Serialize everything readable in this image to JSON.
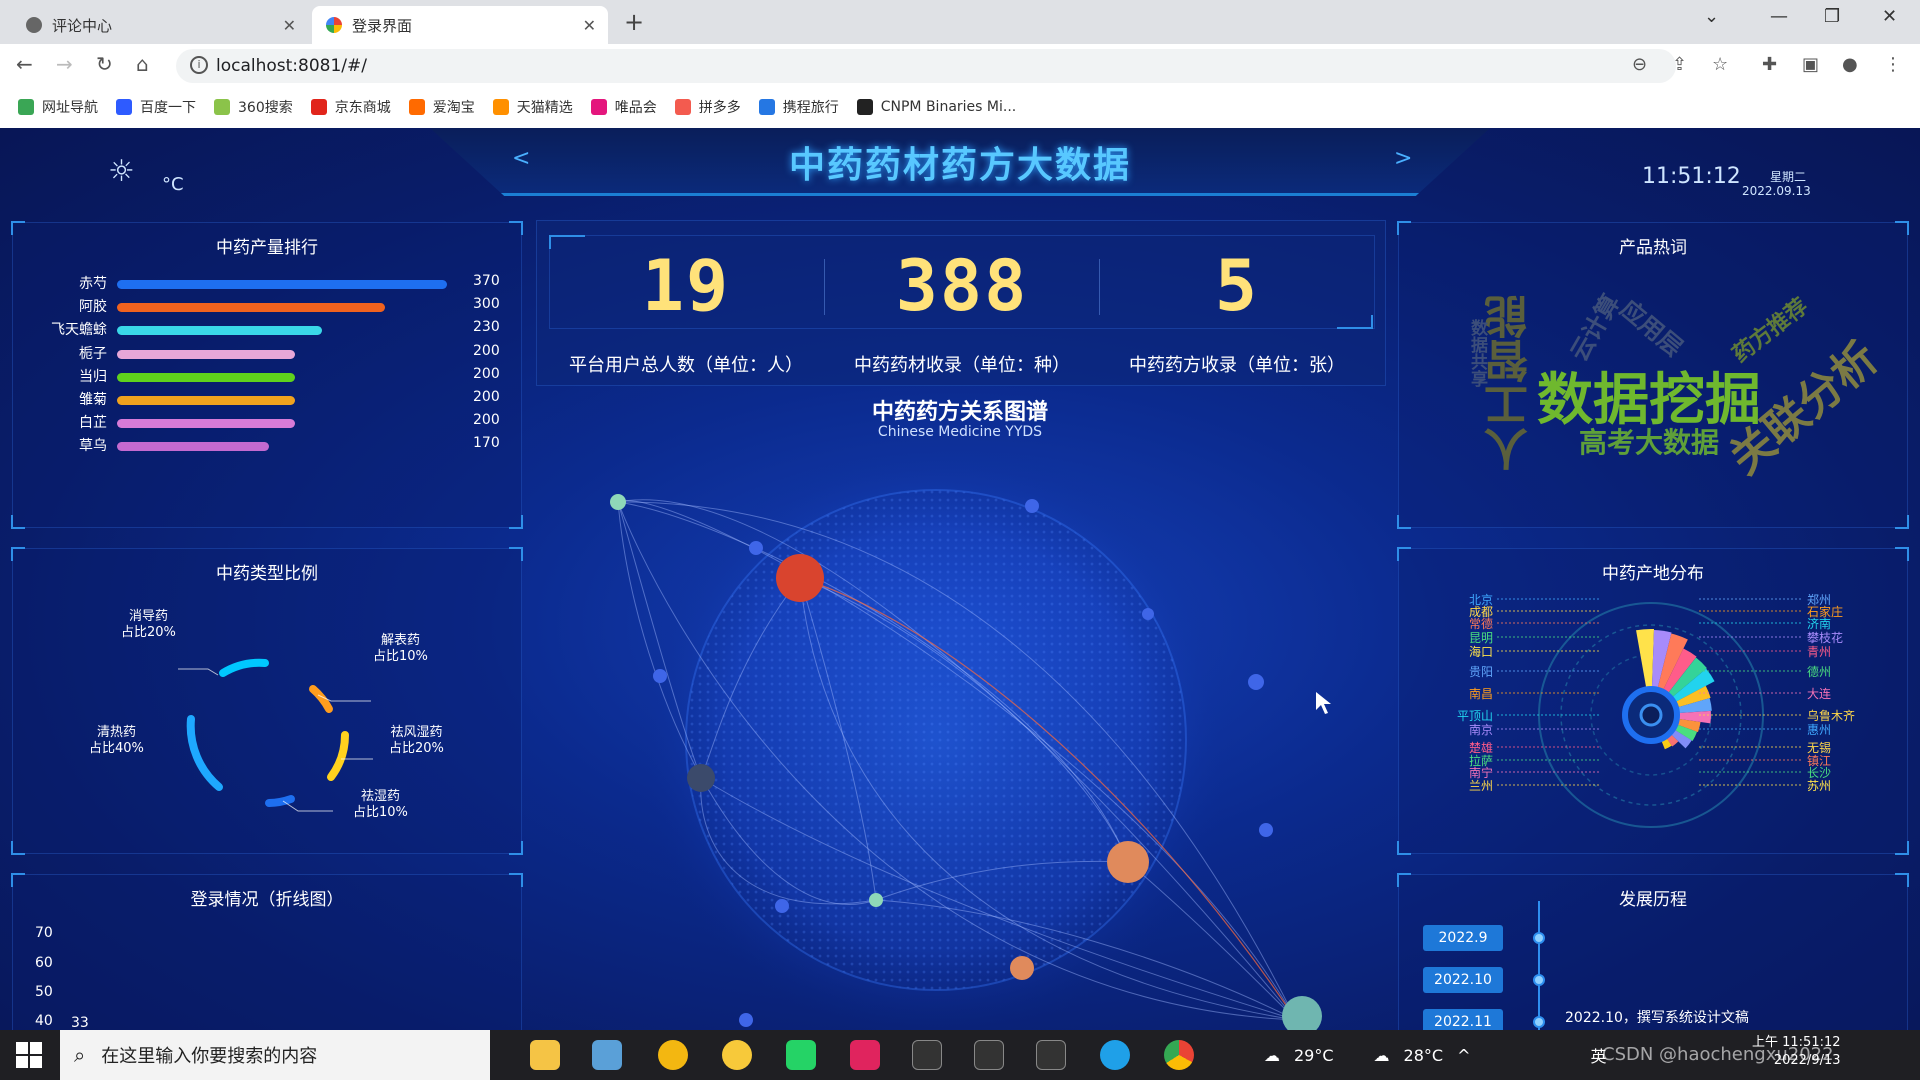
{
  "browser": {
    "tabs": [
      {
        "title": "评论中心",
        "active": false
      },
      {
        "title": "登录界面",
        "active": true
      }
    ],
    "url": "localhost:8081/#/",
    "bookmarks": [
      "网址导航",
      "百度一下",
      "360搜索",
      "京东商城",
      "爱淘宝",
      "天猫精选",
      "唯品会",
      "拼多多",
      "携程旅行",
      "CNPM Binaries Mi..."
    ]
  },
  "header": {
    "title": "中药药材药方大数据",
    "temp_unit": "°C",
    "time": "11:51:12",
    "weekday": "星期二",
    "date": "2022.09.13"
  },
  "rank": {
    "title": "中药产量排行",
    "items": [
      {
        "name": "赤芍",
        "value": 370,
        "color": "#1e6ff0"
      },
      {
        "name": "阿胶",
        "value": 300,
        "color": "#f0621e"
      },
      {
        "name": "飞天蟾蜍",
        "value": 230,
        "color": "#3ad8e8"
      },
      {
        "name": "栀子",
        "value": 200,
        "color": "#e7a7d8"
      },
      {
        "name": "当归",
        "value": 200,
        "color": "#5fd21c"
      },
      {
        "name": "雏菊",
        "value": 200,
        "color": "#f0a21e"
      },
      {
        "name": "白芷",
        "value": 200,
        "color": "#d77bd8"
      },
      {
        "name": "草乌",
        "value": 170,
        "color": "#c46ad0"
      }
    ]
  },
  "type_ratio": {
    "title": "中药类型比例",
    "items": [
      {
        "name": "消导药",
        "ratio": "占比20%"
      },
      {
        "name": "解表药",
        "ratio": "占比10%"
      },
      {
        "name": "祛风湿药",
        "ratio": "占比20%"
      },
      {
        "name": "祛湿药",
        "ratio": "占比10%"
      },
      {
        "name": "清热药",
        "ratio": "占比40%"
      }
    ]
  },
  "login": {
    "title": "登录情况（折线图）",
    "yticks": [
      "70",
      "60",
      "50",
      "40"
    ],
    "first_value": "33"
  },
  "stats": [
    {
      "value": "19",
      "label": "平台用户总人数（单位：人）"
    },
    {
      "value": "388",
      "label": "中药药材收录（单位：种）"
    },
    {
      "value": "5",
      "label": "中药药方收录（单位：张）"
    }
  ],
  "graph": {
    "title": "中药药方关系图谱",
    "subtitle": "Chinese Medicine YYDS"
  },
  "hot": {
    "title": "产品热词",
    "words": [
      "数据挖掘",
      "人工智能",
      "关联分析",
      "高考大数据",
      "药方推荐",
      "应用层",
      "云计算",
      "数据共享"
    ]
  },
  "origin": {
    "title": "中药产地分布",
    "left_labels": [
      "北京",
      "成都",
      "常德",
      "昆明",
      "海口",
      "贵阳",
      "南昌",
      "平顶山",
      "南京",
      "楚雄",
      "拉萨",
      "南宁",
      "兰州"
    ],
    "right_labels": [
      "郑州",
      "石家庄",
      "济南",
      "攀枝花",
      "青州",
      "德州",
      "大连",
      "乌鲁木齐",
      "惠州",
      "无锡",
      "镇江",
      "长沙",
      "苏州"
    ]
  },
  "history": {
    "title": "发展历程",
    "items": [
      "2022.9",
      "2022.10",
      "2022.11"
    ],
    "note": "2022.10，撰写系统设计文稿"
  },
  "taskbar": {
    "search_placeholder": "在这里输入你要搜索的内容",
    "weather1": "29°C",
    "weather2": "28°C",
    "ime": "英",
    "time": "上午 11:51:12",
    "date": "2022/9/13",
    "watermark": "CSDN @haochengxu2022"
  }
}
